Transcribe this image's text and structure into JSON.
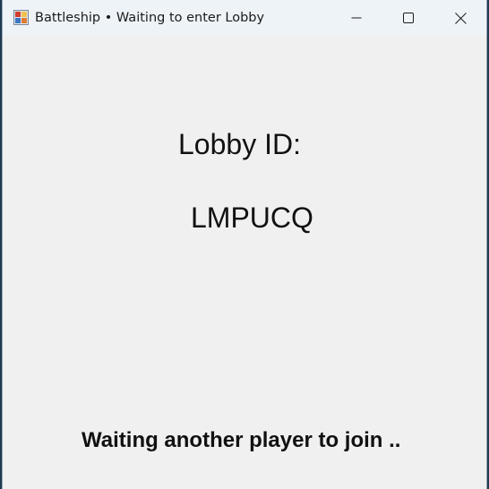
{
  "window": {
    "title": "Battleship • Waiting to enter Lobby",
    "icon": "battleship-app-icon",
    "controls": {
      "minimize_icon": "minimize-icon",
      "maximize_icon": "maximize-icon",
      "close_icon": "close-icon"
    }
  },
  "lobby": {
    "label": "Lobby ID:",
    "code": "LMPUCQ"
  },
  "status": {
    "message": "Waiting another player to join .."
  },
  "colors": {
    "titlebar_bg": "#eef3f8",
    "client_bg": "#f0f0f0",
    "text": "#111111"
  }
}
